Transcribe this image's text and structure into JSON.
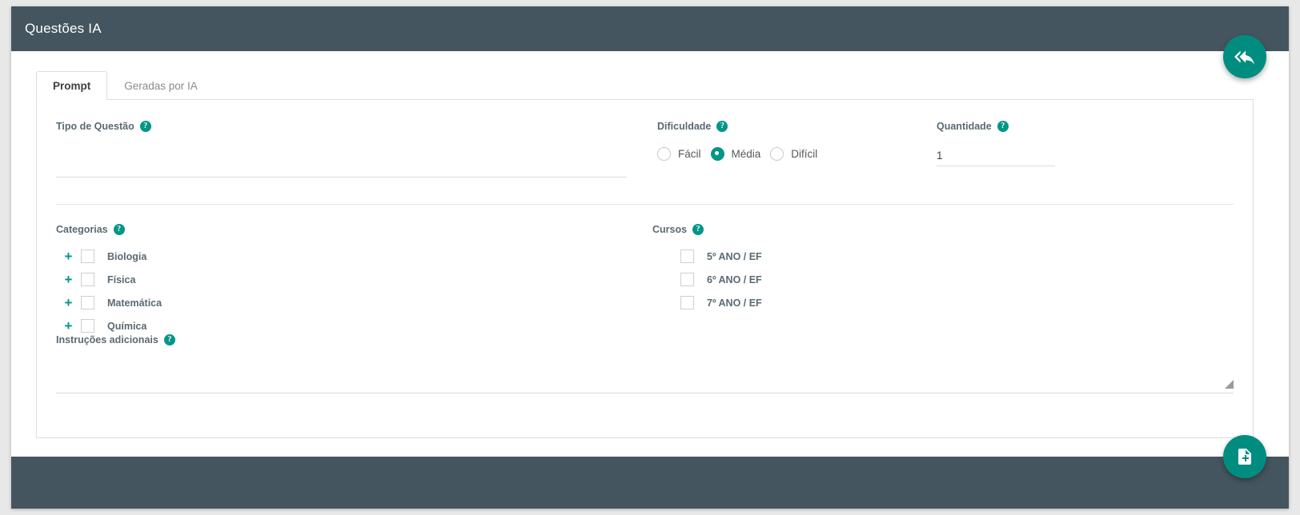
{
  "window": {
    "title": "Questões IA"
  },
  "tabs": [
    {
      "label": "Prompt",
      "active": true
    },
    {
      "label": "Geradas por IA",
      "active": false
    }
  ],
  "form": {
    "tipo_questao": {
      "label": "Tipo de Questão",
      "help_icon": "help-circle-icon",
      "value": "",
      "placeholder": ""
    },
    "dificuldade": {
      "label": "Dificuldade",
      "help_icon": "help-circle-icon",
      "options": [
        {
          "label": "Fácil",
          "selected": false
        },
        {
          "label": "Média",
          "selected": true
        },
        {
          "label": "Difícil",
          "selected": false
        }
      ],
      "selected_value": "Média"
    },
    "quantidade": {
      "label": "Quantidade",
      "help_icon": "help-circle-icon",
      "value": "1",
      "placeholder": ""
    },
    "categorias": {
      "label": "Categorias",
      "help_icon": "help-circle-icon",
      "items": [
        {
          "label": "Biologia",
          "checked": false,
          "expandable": true,
          "expander": "+"
        },
        {
          "label": "Física",
          "checked": false,
          "expandable": true,
          "expander": "+"
        },
        {
          "label": "Matemática",
          "checked": false,
          "expandable": true,
          "expander": "+"
        },
        {
          "label": "Química",
          "checked": false,
          "expandable": true,
          "expander": "+"
        }
      ]
    },
    "cursos": {
      "label": "Cursos",
      "help_icon": "help-circle-icon",
      "items": [
        {
          "label": "5º ANO / EF",
          "checked": false,
          "expandable": false
        },
        {
          "label": "6º ANO / EF",
          "checked": false,
          "expandable": false
        },
        {
          "label": "7º ANO / EF",
          "checked": false,
          "expandable": false
        }
      ]
    },
    "instrucoes": {
      "label": "Instruções adicionais",
      "help_icon": "help-circle-icon",
      "value": "",
      "placeholder": ""
    }
  },
  "actions": {
    "back": {
      "icon": "reply-all-back-icon",
      "tooltip": "Voltar"
    },
    "add": {
      "icon": "note-add-icon",
      "tooltip": "Gerar"
    }
  },
  "colors": {
    "header": "#44555f",
    "accent": "#009688",
    "fab": "#008d80",
    "label_text": "#5a6a72",
    "panel_border": "#dddddd",
    "page_background": "#e8e8e8"
  }
}
